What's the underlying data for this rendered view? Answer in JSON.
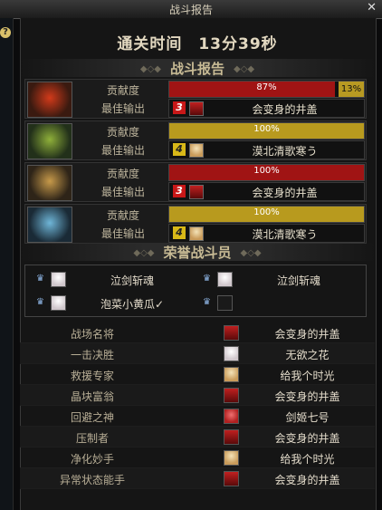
{
  "window": {
    "title": "战斗报告",
    "close_icon": "✕"
  },
  "clear_time": "通关时间　13分39秒",
  "battle_report": {
    "heading": "战斗报告",
    "rows": [
      {
        "contribution_label": "贡献度",
        "best_output_label": "最佳输出",
        "contribution_percent": 87,
        "contribution_text": "87%",
        "side_text": "13%",
        "bar_color": "#a01414",
        "rank_badge": "3",
        "badge_color": "#c81818",
        "portrait": "red-helmet-portrait",
        "name": "会变身的井盖"
      },
      {
        "contribution_label": "贡献度",
        "best_output_label": "最佳输出",
        "contribution_percent": 100,
        "contribution_text": "100%",
        "bar_color": "#b89a1e",
        "rank_badge": "4",
        "badge_color": "#d8b818",
        "portrait": "green-helmet-portrait",
        "name": "漠北清歌寒う"
      },
      {
        "contribution_label": "贡献度",
        "best_output_label": "最佳输出",
        "contribution_percent": 100,
        "contribution_text": "100%",
        "bar_color": "#a01414",
        "rank_badge": "3",
        "badge_color": "#c81818",
        "portrait": "bronze-helmet-portrait",
        "name": "会变身的井盖"
      },
      {
        "contribution_label": "贡献度",
        "best_output_label": "最佳输出",
        "contribution_percent": 100,
        "contribution_text": "100%",
        "bar_color": "#b89a1e",
        "rank_badge": "4",
        "badge_color": "#d8b818",
        "portrait": "blue-helmet-portrait",
        "name": "漠北清歌寒う"
      }
    ]
  },
  "honor": {
    "heading": "荣誉战斗员",
    "members": [
      {
        "name": "泣剑斩魂",
        "portrait": "white-hair-portrait"
      },
      {
        "name": "泣剑斩魂",
        "portrait": "white-hair-portrait"
      },
      {
        "name": "泡菜小黄瓜✓",
        "portrait": "white-hair-portrait"
      },
      {
        "name": "",
        "portrait": "empty-portrait"
      }
    ]
  },
  "titles": [
    {
      "label": "战场名将",
      "name": "会变身的井盖",
      "portrait": "red-p"
    },
    {
      "label": "一击决胜",
      "name": "无欲之花",
      "portrait": "white-p"
    },
    {
      "label": "救援专家",
      "name": "给我个时光",
      "portrait": "blonde"
    },
    {
      "label": "晶块富翁",
      "name": "会变身的井盖",
      "portrait": "red-p"
    },
    {
      "label": "回避之神",
      "name": "剑姬七号",
      "portrait": "pink-p"
    },
    {
      "label": "压制者",
      "name": "会变身的井盖",
      "portrait": "red-p"
    },
    {
      "label": "净化妙手",
      "name": "给我个时光",
      "portrait": "blonde"
    },
    {
      "label": "异常状态能手",
      "name": "会变身的井盖",
      "portrait": "red-p"
    }
  ]
}
